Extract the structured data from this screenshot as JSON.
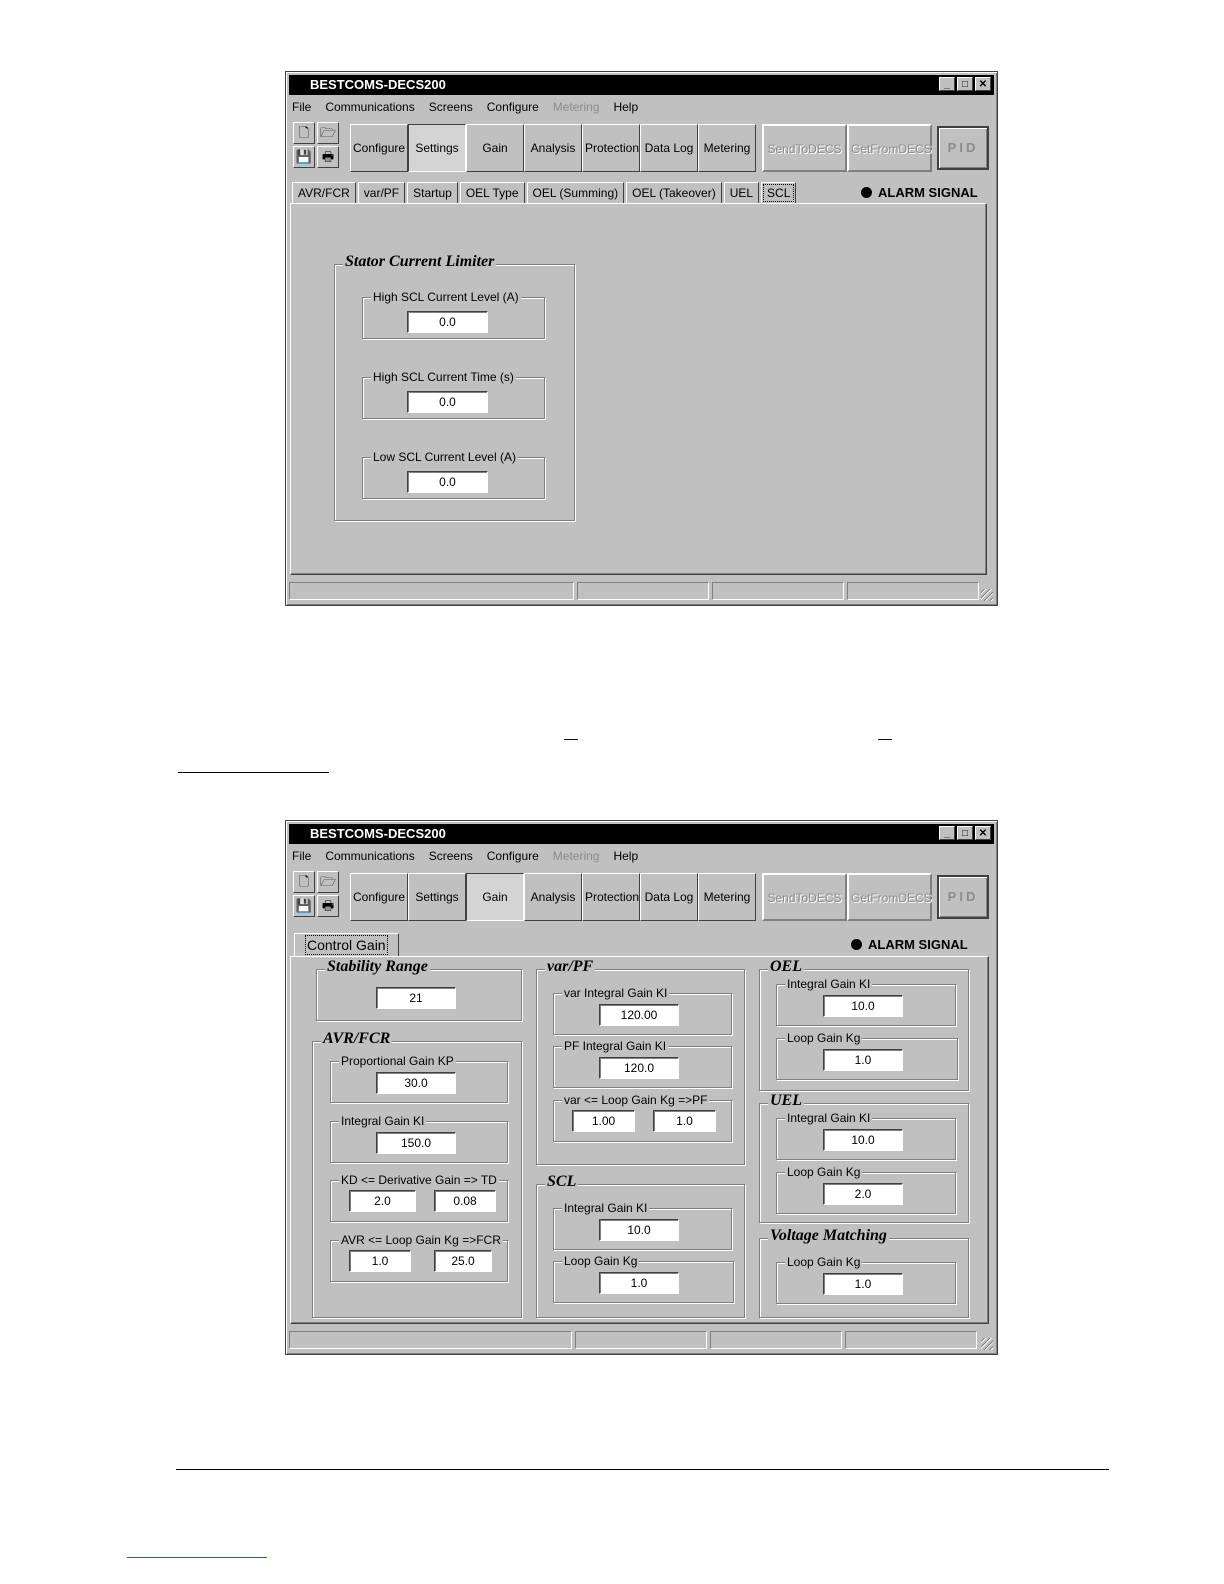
{
  "app": {
    "title": "BESTCOMS-DECS200",
    "window_controls": {
      "minimize": "_",
      "maximize": "□",
      "close": "✕"
    },
    "menu": [
      "File",
      "Communications",
      "Screens",
      "Configure",
      "Metering",
      "Help"
    ],
    "icons": {
      "new": "🗋",
      "open": "🗁",
      "save": "💾",
      "print": "🖶"
    },
    "toolbar": [
      "Configure",
      "Settings",
      "Gain",
      "Analysis",
      "Protection",
      "Data Log",
      "Metering"
    ],
    "send_label": "SendToDECS",
    "get_label": "GetFromDECS",
    "pid_label": "PID",
    "alarm_label": "ALARM SIGNAL"
  },
  "window1": {
    "tabs": [
      "AVR/FCR",
      "var/PF",
      "Startup",
      "OEL Type",
      "OEL (Summing)",
      "OEL (Takeover)",
      "UEL",
      "SCL"
    ],
    "group_title": "Stator Current Limiter",
    "fields": [
      {
        "label": "High SCL Current Level (A)",
        "value": "0.0"
      },
      {
        "label": "High SCL Current Time (s)",
        "value": "0.0"
      },
      {
        "label": "Low SCL Current Level (A)",
        "value": "0.0"
      }
    ]
  },
  "page_marks": {
    "dash1": "—",
    "dash2": "—"
  },
  "window2": {
    "tab": "Control Gain",
    "stability": {
      "title": "Stability Range",
      "value": "21"
    },
    "avr_fcr": {
      "title": "AVR/FCR",
      "kp_label": "Proportional Gain KP",
      "kp": "30.0",
      "ki_label": "Integral Gain KI",
      "ki": "150.0",
      "kd_label": "KD <= Derivative Gain => TD",
      "kd": "2.0",
      "td": "0.08",
      "loop_label": "AVR <= Loop Gain Kg =>FCR",
      "avr": "1.0",
      "fcr": "25.0"
    },
    "var_pf": {
      "title": "var/PF",
      "var_ki_label": "var Integral Gain KI",
      "var_ki": "120.00",
      "pf_ki_label": "PF Integral Gain KI",
      "pf_ki": "120.0",
      "loop_label": "var <= Loop Gain Kg =>PF",
      "var_kg": "1.00",
      "pf_kg": "1.0"
    },
    "scl": {
      "title": "SCL",
      "ki_label": "Integral Gain KI",
      "ki": "10.0",
      "kg_label": "Loop Gain Kg",
      "kg": "1.0"
    },
    "oel": {
      "title": "OEL",
      "ki_label": "Integral Gain KI",
      "ki": "10.0",
      "kg_label": "Loop Gain Kg",
      "kg": "1.0"
    },
    "uel": {
      "title": "UEL",
      "ki_label": "Integral Gain KI",
      "ki": "10.0",
      "kg_label": "Loop Gain Kg",
      "kg": "2.0"
    },
    "voltage_matching": {
      "title": "Voltage Matching",
      "kg_label": "Loop Gain Kg",
      "kg": "1.0"
    }
  }
}
